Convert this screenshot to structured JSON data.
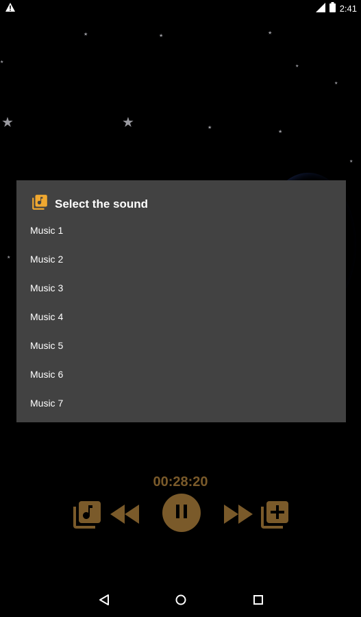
{
  "status_bar": {
    "time": "2:41",
    "icons": [
      "alert-icon",
      "signal-icon",
      "battery-icon"
    ]
  },
  "dialog": {
    "title": "Select the sound",
    "icon": "music-library-icon",
    "items": [
      "Music 1",
      "Music 2",
      "Music 3",
      "Music 4",
      "Music 5",
      "Music 6",
      "Music 7"
    ]
  },
  "player": {
    "timer": "00:28:20",
    "accent_color": "#7a5a2a",
    "controls": [
      "music-library-icon",
      "rewind-icon",
      "pause-icon",
      "fast-forward-icon",
      "playlist-add-icon"
    ]
  },
  "colors": {
    "dialog_bg": "#424242",
    "background": "#000000",
    "dialog_icon": "#f0a830"
  },
  "nav_bar": {
    "buttons": [
      "back-icon",
      "home-icon",
      "recents-icon"
    ]
  }
}
